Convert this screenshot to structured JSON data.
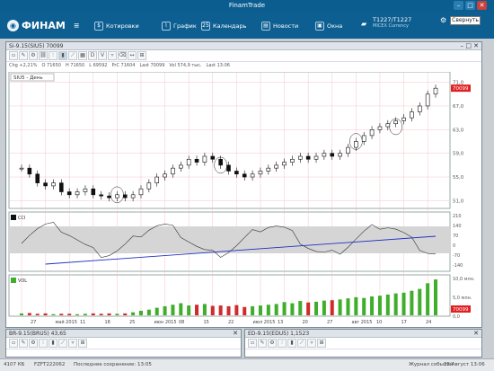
{
  "app": {
    "title": "FinamTrade"
  },
  "window_controls": {
    "min": "–",
    "max": "□",
    "close": "✕"
  },
  "nav": {
    "logo": "ФИНАМ",
    "menu_icon": "≡",
    "items": [
      {
        "label": "Котировки",
        "icon": "quotes-icon"
      },
      {
        "label": "График",
        "icon": "chart-icon"
      },
      {
        "label": "Календарь",
        "icon": "calendar-icon"
      },
      {
        "label": "Новости",
        "icon": "news-icon"
      },
      {
        "label": "Окна",
        "icon": "windows-icon"
      }
    ],
    "account": {
      "title": "T1227/T1227",
      "sub": "MICEX Currency"
    },
    "collapse_label": "Свернуть"
  },
  "chart_window": {
    "title": "Si-9.15(SIU5) 70099",
    "toolbar": [
      "D",
      "V"
    ],
    "quotes": [
      {
        "label": "Chg",
        "value": "+2,21%"
      },
      {
        "label": "O",
        "value": "71650"
      },
      {
        "label": "H",
        "value": "71650"
      },
      {
        "label": "L",
        "value": "69592"
      },
      {
        "label": "PrC",
        "value": "71604"
      },
      {
        "label": "Last",
        "value": "70099"
      },
      {
        "label": "Vol",
        "value": "574,9 тыс."
      },
      {
        "label": "",
        "value": "Last 13:06"
      }
    ],
    "legend": "SIU5 - День",
    "price_axis": [
      "71,0",
      "67,0",
      "63,0",
      "59,0",
      "55,0",
      "51,0"
    ],
    "price_badge": "70099",
    "cci_axis": [
      "210",
      "140",
      "70",
      "0",
      "-70",
      "-140"
    ],
    "vol_axis": [
      "10,0 млн.",
      "5,0 млн.",
      "0,0"
    ],
    "vol_badge": "70099",
    "cci_label": "CCI",
    "vol_label": "VOL",
    "x_labels": [
      "27",
      "май 2015",
      "11",
      "18",
      "25",
      "июн 2015",
      "08",
      "15",
      "22",
      "июл 2015",
      "13",
      "20",
      "27",
      "авг 2015",
      "10",
      "17",
      "24"
    ]
  },
  "chart_data": {
    "type": "candlestick",
    "title": "Si-9.15(SIU5) 70099",
    "series": [
      {
        "name": "SIU5 - День",
        "values": [
          56.5,
          55.5,
          54.0,
          53.5,
          54.0,
          52.5,
          52.0,
          52.5,
          53.0,
          52.0,
          51.8,
          51.5,
          52.0,
          51.5,
          52.0,
          53.0,
          54.0,
          55.0,
          55.5,
          56.5,
          57.0,
          58.0,
          57.5,
          58.5,
          58.0,
          57.0,
          56.0,
          55.5,
          55.0,
          55.5,
          56.0,
          56.5,
          57.0,
          57.5,
          58.0,
          58.5,
          58.0,
          58.5,
          59.0,
          58.5,
          59.0,
          60.0,
          61.0,
          62.0,
          63.0,
          63.5,
          64.0,
          64.5,
          65.0,
          66.0,
          67.0,
          69.0,
          70.0
        ]
      }
    ],
    "ylim": [
      50,
      72
    ],
    "volume": [
      0.5,
      0.6,
      0.4,
      0.5,
      0.3,
      0.4,
      0.4,
      0.3,
      0.4,
      0.5,
      0.4,
      0.5,
      0.4,
      0.5,
      0.8,
      1.2,
      1.5,
      2.0,
      2.4,
      2.8,
      3.2,
      2.6,
      2.8,
      3.0,
      2.5,
      2.6,
      2.4,
      2.7,
      2.2,
      2.4,
      2.6,
      2.8,
      3.0,
      3.5,
      3.2,
      3.8,
      3.4,
      3.6,
      3.9,
      4.0,
      4.2,
      4.5,
      4.8,
      4.6,
      5.0,
      5.2,
      5.5,
      5.8,
      6.0,
      6.5,
      7.0,
      8.5,
      9.5
    ]
  },
  "panes": [
    {
      "title": "BR-9.15(BRU5) 43,65"
    },
    {
      "title": "ED-9.15(EDU5) 1,1523"
    }
  ],
  "status": {
    "left": "4107 КБ",
    "account": "FZFT222062",
    "saved": "Последнее сохранение: 13:05",
    "log": "Журнал событий",
    "date": "25 Август 13:06"
  }
}
